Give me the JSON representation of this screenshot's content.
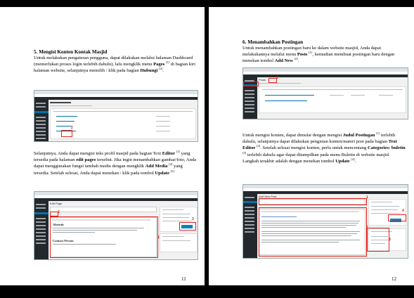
{
  "left_page": {
    "heading": "5.  Mengisi Konten Kontak Masjid",
    "para1": [
      {
        "t": "Untuk melakukan pengaturan pengguna, dapat dilakukan melalui halaman Dashboard (memerlukan proses login terlebih dahulu), lalu mengklik menu "
      },
      {
        "t": "Pages",
        "b": true
      },
      {
        "t": " "
      },
      {
        "t": "[1]",
        "s": true
      },
      {
        "t": " di bagian kiri halaman website, selanjutnya memilih / klik pada bagian "
      },
      {
        "t": "Hubungi",
        "b": true
      },
      {
        "t": " "
      },
      {
        "t": "[2]",
        "s": true
      },
      {
        "t": "."
      }
    ],
    "para2": [
      {
        "t": "Selanjutnya, Anda dapat mengisi teks profil masjid pada bagian Text "
      },
      {
        "t": "Editor",
        "b": true
      },
      {
        "t": " "
      },
      {
        "t": "[1]",
        "s": true
      },
      {
        "t": " yang tersedia pada halaman "
      },
      {
        "t": "edit pages",
        "b": true
      },
      {
        "t": " tersebut. Jika ingin menambahkan gambar/foto, Anda dapat menggunakan fungsi tambah media dengan mengklik "
      },
      {
        "t": "Add Media",
        "b": true
      },
      {
        "t": " "
      },
      {
        "t": "[2]",
        "s": true
      },
      {
        "t": " yang tersedia. Setelah selesai, Anda dapat menekan / klik pada tombol "
      },
      {
        "t": "Update",
        "b": true
      },
      {
        "t": " "
      },
      {
        "t": "[3]",
        "s": true
      }
    ],
    "shot1": {
      "marker": "2"
    },
    "shot2": {
      "title": "Edit Page",
      "heading1": "Abstrak",
      "heading2": "Contact Person",
      "markers": [
        "1",
        "2",
        "3"
      ]
    },
    "page_number": "11"
  },
  "right_page": {
    "heading": "6.  Menambahkan Postingan",
    "para1": [
      {
        "t": "Untuk menambahkan postingan baru ke dalam website masjid, Anda dapat melakukannya melalui menu "
      },
      {
        "t": "Posts",
        "b": true
      },
      {
        "t": " "
      },
      {
        "t": "[1]",
        "s": true
      },
      {
        "t": ", kemudian membuat postingan baru dengan menekan tombol "
      },
      {
        "t": "Add New",
        "b": true
      },
      {
        "t": " "
      },
      {
        "t": "[2]",
        "s": true
      },
      {
        "t": "."
      }
    ],
    "para2": [
      {
        "t": "Untuk mengisi konten, dapat dimulai dengan mengisi "
      },
      {
        "t": "Judul Postingan",
        "b": true
      },
      {
        "t": " "
      },
      {
        "t": "[1]",
        "s": true
      },
      {
        "t": " terlebih dahulu, selanjutnya dapat dilakukan pengisian konten/materi post pada bagian "
      },
      {
        "t": "Text Editor",
        "b": true
      },
      {
        "t": " "
      },
      {
        "t": "[2]",
        "s": true
      },
      {
        "t": ". Setelah selesai mengisi konten, perlu untuk mencentang "
      },
      {
        "t": "Categories: buletin",
        "b": true
      },
      {
        "t": " "
      },
      {
        "t": "[3]",
        "s": true
      },
      {
        "t": " terlebih dahulu agar dapat ditampilkan pada menu Buletin di website masjid. Langkah terakhir adalah dengan menekan tombol "
      },
      {
        "t": "Update",
        "b": true
      },
      {
        "t": " "
      },
      {
        "t": "[4]",
        "s": true
      },
      {
        "t": "."
      }
    ],
    "shot1": {
      "title": "Posts",
      "markers": [
        "1",
        "2"
      ]
    },
    "shot2": {
      "title": "Add New Post",
      "markers": [
        "1",
        "2",
        "3",
        "4"
      ]
    },
    "page_number": "12"
  },
  "colors": {
    "annotation_red": "#e0201a",
    "wp_sidebar": "#23282d",
    "wp_blue": "#0073aa"
  }
}
